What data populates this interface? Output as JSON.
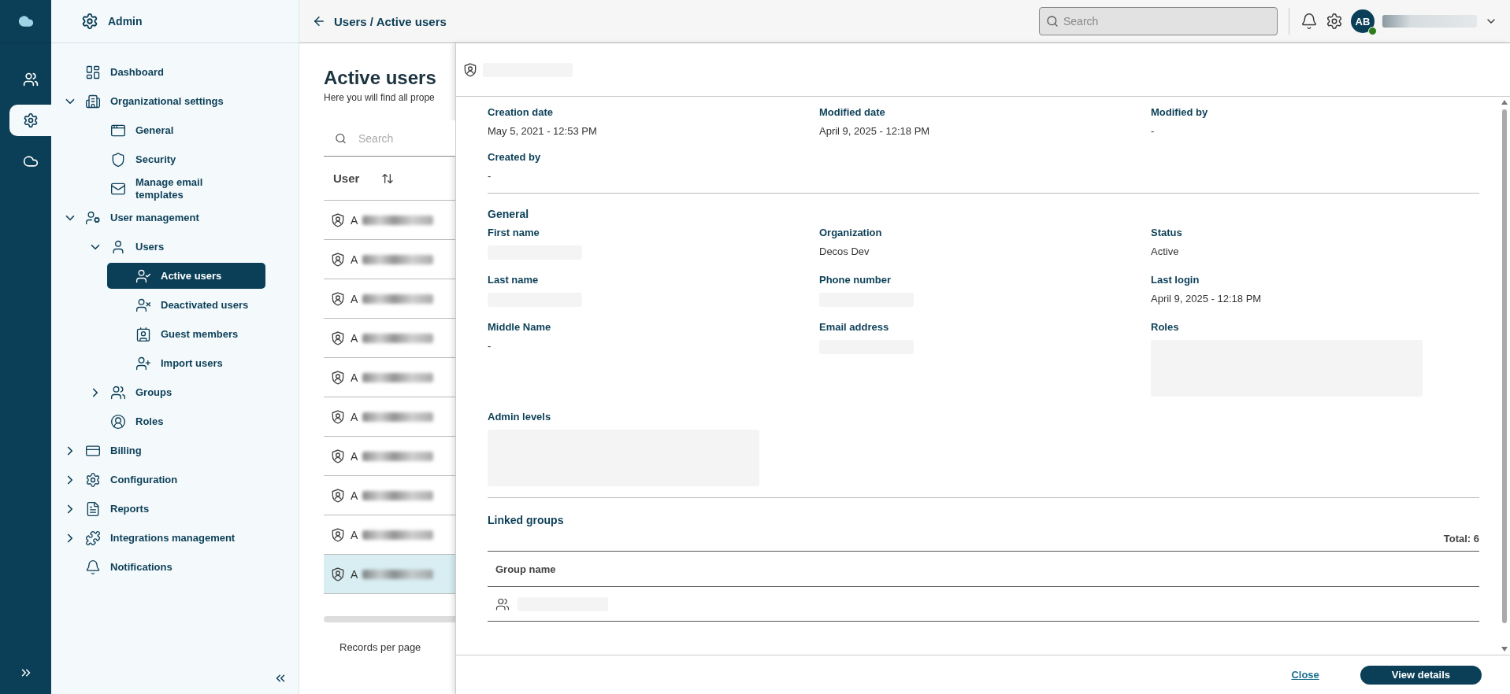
{
  "rail": {
    "items": [
      {
        "selected": false
      },
      {
        "selected": true
      },
      {
        "selected": false
      }
    ]
  },
  "sidebar": {
    "title": "Admin",
    "items": [
      {
        "label": "Dashboard",
        "selected": false
      },
      {
        "label": "Organizational settings",
        "selected": false,
        "expanded": true,
        "children": [
          {
            "label": "General",
            "selected": false
          },
          {
            "label": "Security",
            "selected": false
          },
          {
            "label": "Manage email templates",
            "selected": false
          }
        ]
      },
      {
        "label": "User management",
        "selected": false,
        "expanded": true,
        "children": [
          {
            "label": "Users",
            "selected": false,
            "expanded": true,
            "children": [
              {
                "label": "Active users",
                "selected": true
              },
              {
                "label": "Deactivated users",
                "selected": false
              },
              {
                "label": "Guest members",
                "selected": false
              },
              {
                "label": "Import users",
                "selected": false
              }
            ]
          },
          {
            "label": "Groups",
            "selected": false,
            "expanded": false
          },
          {
            "label": "Roles",
            "selected": false
          }
        ]
      },
      {
        "label": "Billing",
        "selected": false,
        "expanded": false
      },
      {
        "label": "Configuration",
        "selected": false,
        "expanded": false
      },
      {
        "label": "Reports",
        "selected": false,
        "expanded": false
      },
      {
        "label": "Integrations management",
        "selected": false,
        "expanded": false
      },
      {
        "label": "Notifications",
        "selected": false
      }
    ]
  },
  "header": {
    "breadcrumb": "Users / Active users",
    "search": {
      "placeholder": "Search"
    },
    "avatar": {
      "initials": "AB",
      "online": true
    }
  },
  "list": {
    "title": "Active users",
    "subtitle": "Here you will find all prope",
    "search": {
      "placeholder": "Search"
    },
    "column": "User",
    "rows": [
      {
        "prefix": "A",
        "selected": false
      },
      {
        "prefix": "A",
        "selected": false
      },
      {
        "prefix": "A",
        "selected": false
      },
      {
        "prefix": "A",
        "selected": false
      },
      {
        "prefix": "A",
        "selected": false
      },
      {
        "prefix": "A",
        "selected": false
      },
      {
        "prefix": "A",
        "selected": false
      },
      {
        "prefix": "A",
        "selected": false
      },
      {
        "prefix": "A",
        "selected": false
      },
      {
        "prefix": "A",
        "selected": true
      }
    ],
    "footer": "Records per page"
  },
  "panel": {
    "sections": [
      {
        "fields": [
          {
            "label": "Creation date",
            "kind": "text",
            "value": "May 5, 2021 - 12:53 PM"
          },
          {
            "label": "Modified date",
            "kind": "text",
            "value": "April 9, 2025 - 12:18 PM"
          },
          {
            "label": "Modified by",
            "kind": "text",
            "value": "-"
          },
          {
            "label": "Created by",
            "kind": "text",
            "value": "-"
          }
        ]
      },
      {
        "title": "General",
        "fields": [
          {
            "label": "First name",
            "kind": "redacted"
          },
          {
            "label": "Organization",
            "kind": "text",
            "value": "Decos Dev"
          },
          {
            "label": "Status",
            "kind": "text",
            "value": "Active"
          },
          {
            "label": "Last name",
            "kind": "redacted"
          },
          {
            "label": "Phone number",
            "kind": "redacted"
          },
          {
            "label": "Last login",
            "kind": "text",
            "value": "April 9, 2025 - 12:18 PM"
          },
          {
            "label": "Middle Name",
            "kind": "text",
            "value": "-"
          },
          {
            "label": "Email address",
            "kind": "redacted"
          },
          {
            "label": "Roles",
            "kind": "redacted_area"
          },
          {
            "label": "Admin levels",
            "kind": "redacted_area"
          }
        ]
      }
    ],
    "linked_groups": {
      "title": "Linked groups",
      "total": "Total: 6",
      "column": "Group name",
      "rows": [
        {
          "kind": "redacted"
        }
      ]
    },
    "actions": {
      "close": "Close",
      "primary": "View details"
    }
  }
}
